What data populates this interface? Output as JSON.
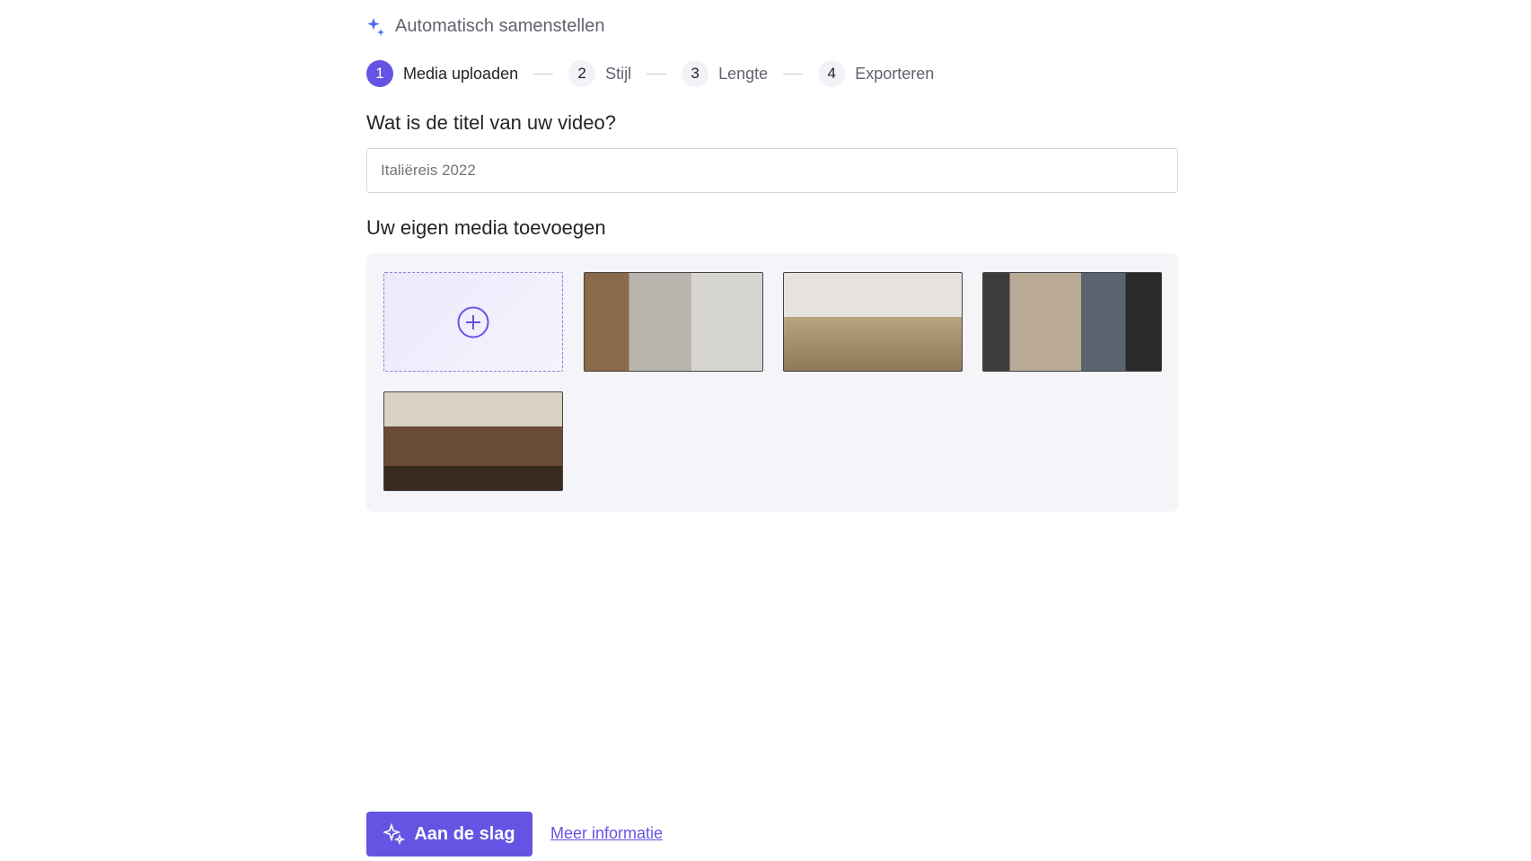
{
  "header": {
    "title": "Automatisch samenstellen",
    "icon": "sparkle-icon"
  },
  "steps": [
    {
      "num": "1",
      "label": "Media uploaden"
    },
    {
      "num": "2",
      "label": "Stijl"
    },
    {
      "num": "3",
      "label": "Lengte"
    },
    {
      "num": "4",
      "label": "Exporteren"
    }
  ],
  "title_section": {
    "heading": "Wat is de titel van uw video?",
    "placeholder": "Italiëreis 2022"
  },
  "media_section": {
    "heading": "Uw eigen media toevoegen"
  },
  "actions": {
    "start_label": "Aan de slag",
    "more_info_label": "Meer informatie"
  },
  "colors": {
    "accent": "#6554e3"
  }
}
